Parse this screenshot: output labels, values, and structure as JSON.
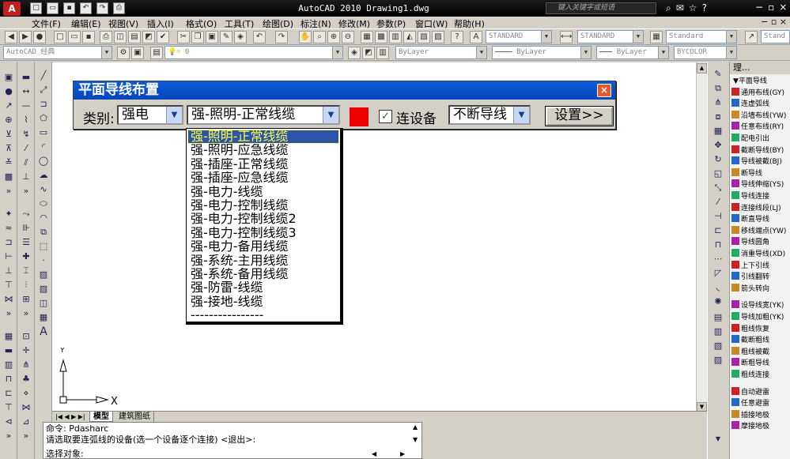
{
  "app": {
    "logo_text": "A",
    "title": "AutoCAD 2010  Drawing1.dwg",
    "search_placeholder": "键入关键字或短语",
    "window_controls": [
      "−",
      "▫",
      "×"
    ]
  },
  "menu": {
    "items": [
      "文件(F)",
      "编辑(E)",
      "视图(V)",
      "插入(I)",
      "格式(O)",
      "工具(T)",
      "绘图(D)",
      "标注(N)",
      "修改(M)",
      "参数(P)",
      "窗口(W)",
      "帮助(H)"
    ],
    "doc_controls": "− ▫ ×"
  },
  "toolbar": {
    "workspace": "AutoCAD 经典",
    "layer": "0",
    "text_style": "STANDARD",
    "dim_style": "STANDARD",
    "table_style": "Standard",
    "multileader_style": "Stand",
    "color": "ByLayer",
    "linetype": "ByLayer",
    "lineweight": "ByLayer",
    "plotstyle": "BYCOLOR"
  },
  "dialog": {
    "title": "平面导线布置",
    "close": "×",
    "category_label": "类别:",
    "category_value": "强电",
    "type_value": "强-照明-正常线缆",
    "connect_label": "连设备",
    "connect_checked": "✓",
    "mode_value": "不断导线",
    "settings_button": "设置>>",
    "swatch_color": "#ee0000"
  },
  "dropdown": {
    "options": [
      "强-照明-正常线缆",
      "强-照明-应急线缆",
      "强-插座-正常线缆",
      "强-插座-应急线缆",
      "强-电力-线缆",
      "强-电力-控制线缆",
      "强-电力-控制线缆2",
      "强-电力-控制线缆3",
      "强-电力-备用线缆",
      "强-系统-主用线缆",
      "强-系统-备用线缆",
      "强-防雷-线缆",
      "强-接地-线缆",
      "----------------"
    ],
    "selected_index": 0
  },
  "tabs": {
    "model": "模型",
    "layout": "建筑图纸"
  },
  "command": {
    "line1": "命令: Pdasharc",
    "line2": "请选取要连弧线的设备(选一个设备逐个连接) <退出>:",
    "line3": "选择对象:"
  },
  "panel": {
    "header": "理...",
    "items": [
      "▼平面导线",
      "通用布线(GY)",
      "连虚弧线",
      "沿墙布线(YW)",
      "任意布线(RY)",
      "配电引出",
      "截断导线(BY)",
      "导线被截(BJ)",
      "断导线",
      "导线伸缩(YS)",
      "导线连接",
      "连接线段(LJ)",
      "断直导线",
      "移线端点(YW)",
      "导线圆角",
      "消重导线(XD)",
      "上下引线",
      "引线翻转",
      "箭头转向",
      "设导线宽(YK)",
      "导线加粗(YK)",
      "粗线恢复",
      "截断粗线",
      "粗线被截",
      "断粗导线",
      "粗线连接",
      "自动避雷",
      "任意避雷",
      "插接地极",
      "摩接地极"
    ]
  },
  "ucs": {
    "x_label": "X",
    "y_label": "Y"
  }
}
